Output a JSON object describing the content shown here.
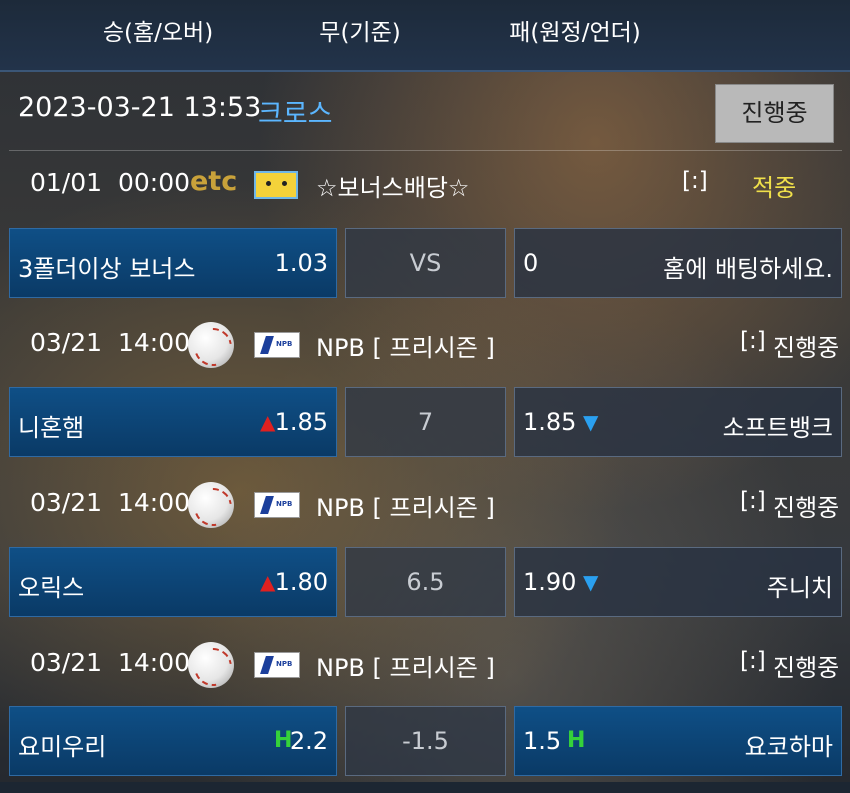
{
  "header": {
    "col1": "승(홈/오버)",
    "col2": "무(기준)",
    "col3": "패(원정/언더)"
  },
  "title": {
    "datetime": "2023-03-21 13:53",
    "type": "크로스",
    "status_button": "진행중"
  },
  "games": [
    {
      "date": "01/01",
      "time": "00:00",
      "icon": "etc-icon",
      "league_icon": "pikachu-icon",
      "league": "☆보너스배당☆",
      "score": "[:]",
      "status": "적중",
      "status_color": "#f0e04a",
      "home": "3폴더이상 보너스",
      "home_odds": "1.03",
      "home_mark": "",
      "mid": "VS",
      "away": "홈에 배팅하세요.",
      "away_odds": "0",
      "away_mark": "",
      "away_selected": false
    },
    {
      "date": "03/21",
      "time": "14:00",
      "icon": "baseball-icon",
      "league_icon": "npb-logo-icon",
      "league": "NPB [ 프리시즌 ]",
      "score": "[:]",
      "status": "진행중",
      "status_color": "#ffffff",
      "home": "니혼햄",
      "home_odds": "1.85",
      "home_mark": "▲",
      "mid": "7",
      "away": "소프트뱅크",
      "away_odds": "1.85",
      "away_mark": "▼",
      "away_selected": false
    },
    {
      "date": "03/21",
      "time": "14:00",
      "icon": "baseball-icon",
      "league_icon": "npb-logo-icon",
      "league": "NPB [ 프리시즌 ]",
      "score": "[:]",
      "status": "진행중",
      "status_color": "#ffffff",
      "home": "오릭스",
      "home_odds": "1.80",
      "home_mark": "▲",
      "mid": "6.5",
      "away": "주니치",
      "away_odds": "1.90",
      "away_mark": "▼",
      "away_selected": false
    },
    {
      "date": "03/21",
      "time": "14:00",
      "icon": "baseball-icon",
      "league_icon": "npb-logo-icon",
      "league": "NPB [ 프리시즌 ]",
      "score": "[:]",
      "status": "진행중",
      "status_color": "#ffffff",
      "home": "요미우리",
      "home_odds": "2.2",
      "home_mark": "H",
      "mid": "-1.5",
      "away": "요코하마",
      "away_odds": "1.5",
      "away_mark": "H",
      "away_selected": true
    }
  ]
}
